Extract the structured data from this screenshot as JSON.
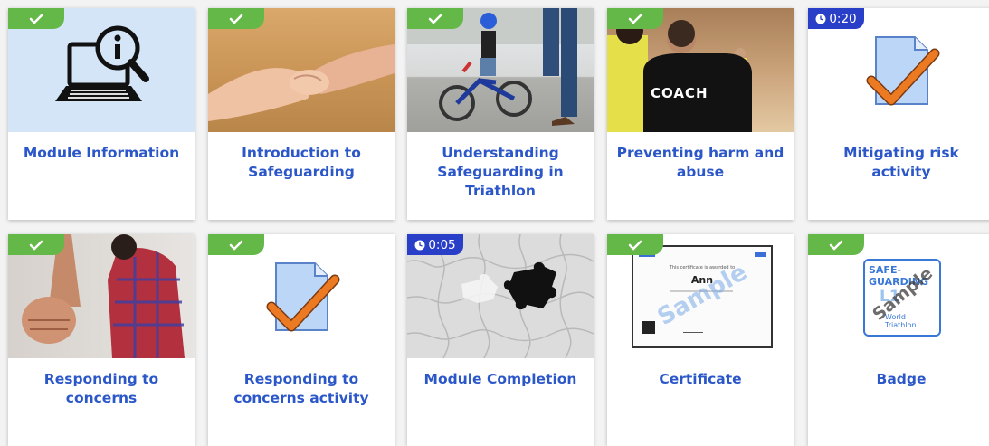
{
  "modules": [
    {
      "title": "Module Information",
      "status": "complete",
      "image": "laptop-info-icon"
    },
    {
      "title": "Introduction to Safeguarding",
      "status": "complete",
      "image": "holding-hands-photo"
    },
    {
      "title": "Understanding Safeguarding in Triathlon",
      "status": "complete",
      "image": "child-bicycle-photo"
    },
    {
      "title": "Preventing harm and abuse",
      "status": "complete",
      "image": "coach-photo",
      "photo_text": "COACH"
    },
    {
      "title": "Mitigating risk activity",
      "status": "timed",
      "duration": "0:20",
      "image": "document-check-icon"
    },
    {
      "title": "Responding to concerns",
      "status": "complete",
      "image": "fist-photo"
    },
    {
      "title": "Responding to concerns activity",
      "status": "complete",
      "image": "document-check-icon"
    },
    {
      "title": "Module Completion",
      "status": "timed",
      "duration": "0:05",
      "image": "puzzle-photo"
    },
    {
      "title": "Certificate",
      "status": "complete",
      "image": "certificate-sample",
      "certificate_text": "This certificate is awarded to",
      "recipient": "Ann",
      "sample_label": "Sample"
    },
    {
      "title": "Badge",
      "status": "complete",
      "image": "safeguarding-badge",
      "badge_line1": "SAFE-",
      "badge_line2": "GUARDING",
      "badge_level": "L1",
      "badge_org1": "World",
      "badge_org2": "Triathlon",
      "sample_label": "Sample"
    }
  ],
  "colors": {
    "accent": "#2b57c9",
    "complete": "#64b848",
    "timed": "#2a3fc8"
  }
}
